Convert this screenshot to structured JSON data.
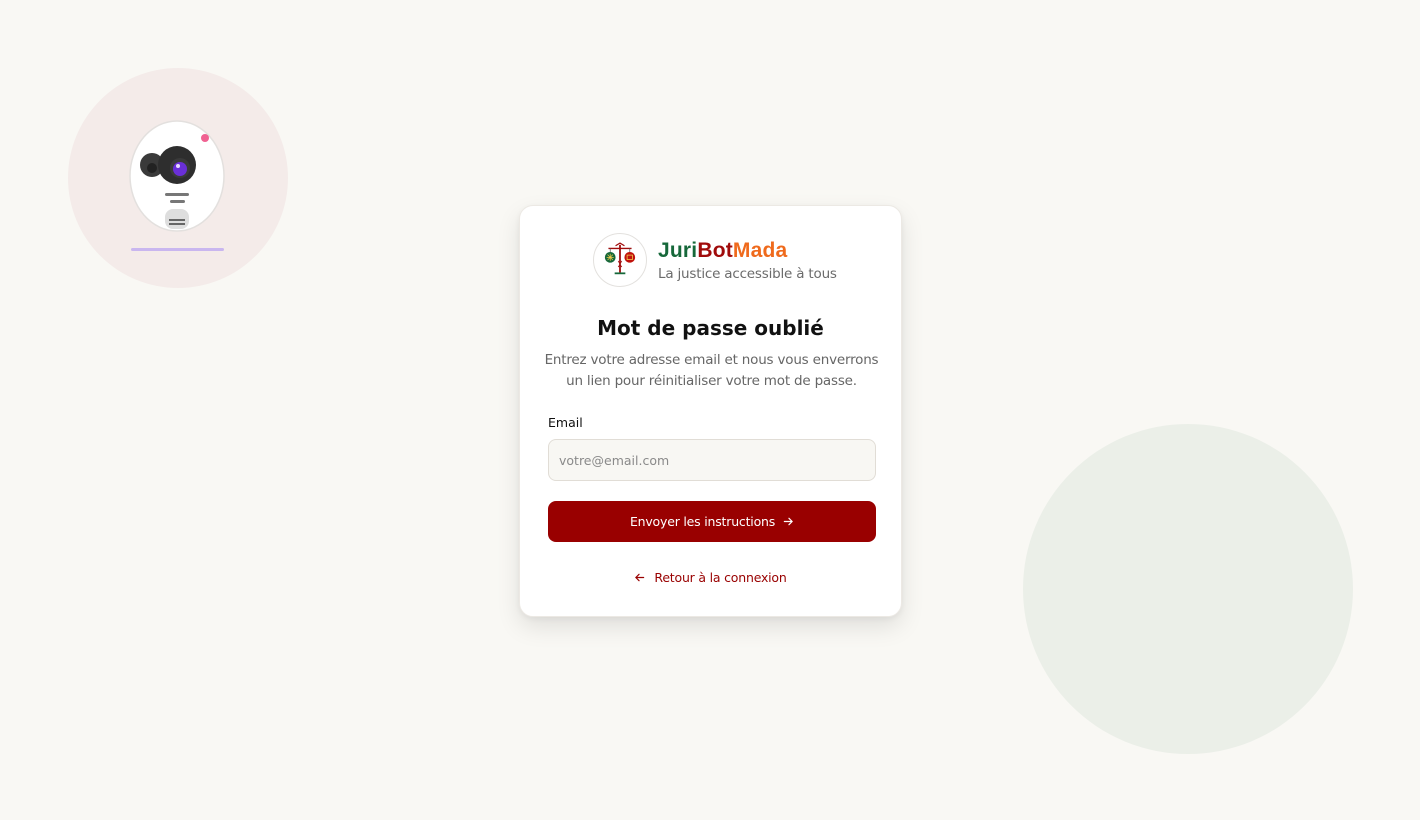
{
  "brand": {
    "name_part1": "Juri",
    "name_part2": "Bot",
    "name_part3": "Mada",
    "tagline": "La justice accessible à tous",
    "logo_icon": "scales-of-justice-icon"
  },
  "form": {
    "title": "Mot de passe oublié",
    "description": "Entrez votre adresse email et nous vous enverrons un lien pour réinitialiser votre mot de passe.",
    "email_label": "Email",
    "email_placeholder": "votre@email.com",
    "email_value": "",
    "submit_label": "Envoyer les instructions",
    "submit_icon": "arrow-right-icon",
    "back_label": "Retour à la connexion",
    "back_icon": "arrow-left-icon"
  },
  "colors": {
    "primary": "#990000",
    "brand_green": "#16683a",
    "brand_red": "#a00b0b",
    "brand_orange": "#ef6a1c",
    "background": "#f9f8f4"
  },
  "decor": {
    "illustration_icon": "robot-camera-icon"
  }
}
